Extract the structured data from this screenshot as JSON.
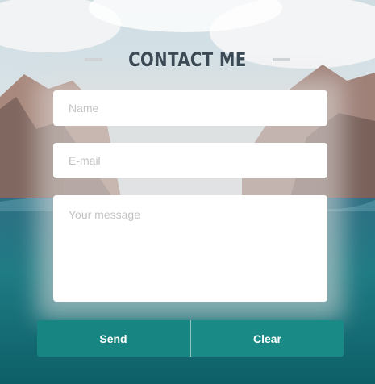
{
  "form": {
    "title": "CONTACT ME",
    "name_placeholder": "Name",
    "email_placeholder": "E-mail",
    "message_placeholder": "Your message",
    "send_label": "Send",
    "clear_label": "Clear"
  },
  "colors": {
    "accent": "#1a8a86",
    "title": "#3c4a55",
    "field_bg": "#ffffff",
    "placeholder": "#c3c3c3"
  }
}
